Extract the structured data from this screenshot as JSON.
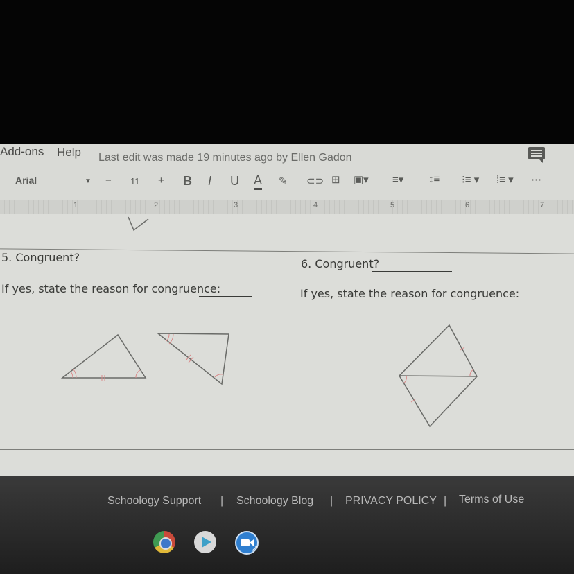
{
  "menubar": {
    "items": [
      "Add-ons",
      "Help"
    ],
    "last_edit": "Last edit was made 19 minutes ago by Ellen Gadon"
  },
  "toolbar": {
    "font": "Arial",
    "font_size": "11",
    "minus": "−",
    "plus": "+",
    "bold": "B",
    "italic": "I",
    "underline": "U",
    "text_color": "A",
    "more": "⋯"
  },
  "ruler": {
    "marks": [
      "1",
      "2",
      "3",
      "4",
      "5",
      "6",
      "7"
    ]
  },
  "questions": [
    {
      "congruent": "5. Congruent?",
      "reason": "If yes, state the reason for congruence:"
    },
    {
      "congruent": "6. Congruent?",
      "reason": "If yes, state the reason for congruence:"
    }
  ],
  "footer": {
    "links": [
      "Schoology Support",
      "Schoology Blog",
      "PRIVACY POLICY",
      "Terms of Use"
    ],
    "separator": "|"
  },
  "colors": {
    "mark_color": "#d98a8a",
    "line_color": "#6a6b68"
  }
}
